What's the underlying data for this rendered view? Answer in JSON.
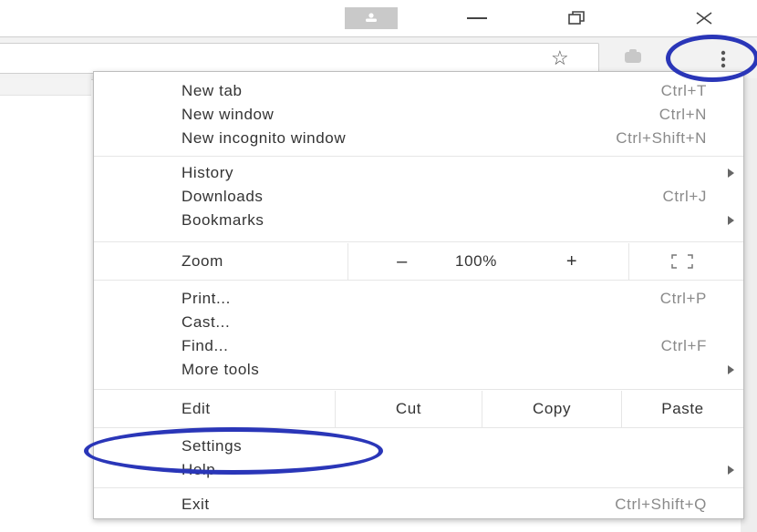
{
  "toolbar": {
    "icons": [
      "profile-icon",
      "minimize-icon",
      "restore-icon",
      "close-icon",
      "star-icon",
      "extension-icon",
      "menu-dots-icon"
    ]
  },
  "menu": {
    "group1": [
      {
        "label": "New tab",
        "shortcut": "Ctrl+T"
      },
      {
        "label": "New window",
        "shortcut": "Ctrl+N"
      },
      {
        "label": "New incognito window",
        "shortcut": "Ctrl+Shift+N"
      }
    ],
    "group2": [
      {
        "label": "History",
        "shortcut": ""
      },
      {
        "label": "Downloads",
        "shortcut": "Ctrl+J"
      },
      {
        "label": "Bookmarks",
        "shortcut": ""
      }
    ],
    "zoom": {
      "label": "Zoom",
      "minus": "–",
      "value": "100%",
      "plus": "+"
    },
    "group3": [
      {
        "label": "Print...",
        "shortcut": "Ctrl+P"
      },
      {
        "label": "Cast...",
        "shortcut": ""
      },
      {
        "label": "Find...",
        "shortcut": "Ctrl+F"
      },
      {
        "label": "More tools",
        "shortcut": ""
      }
    ],
    "edit": {
      "label": "Edit",
      "cut": "Cut",
      "copy": "Copy",
      "paste": "Paste"
    },
    "group4": [
      {
        "label": "Settings",
        "shortcut": ""
      },
      {
        "label": "Help",
        "shortcut": ""
      }
    ],
    "exit": {
      "label": "Exit",
      "shortcut": "Ctrl+Shift+Q"
    }
  },
  "colors": {
    "highlight_ring": "#2a36b8",
    "menu_bg": "#ffffff",
    "toolbar_bg": "#f2f2f2"
  }
}
